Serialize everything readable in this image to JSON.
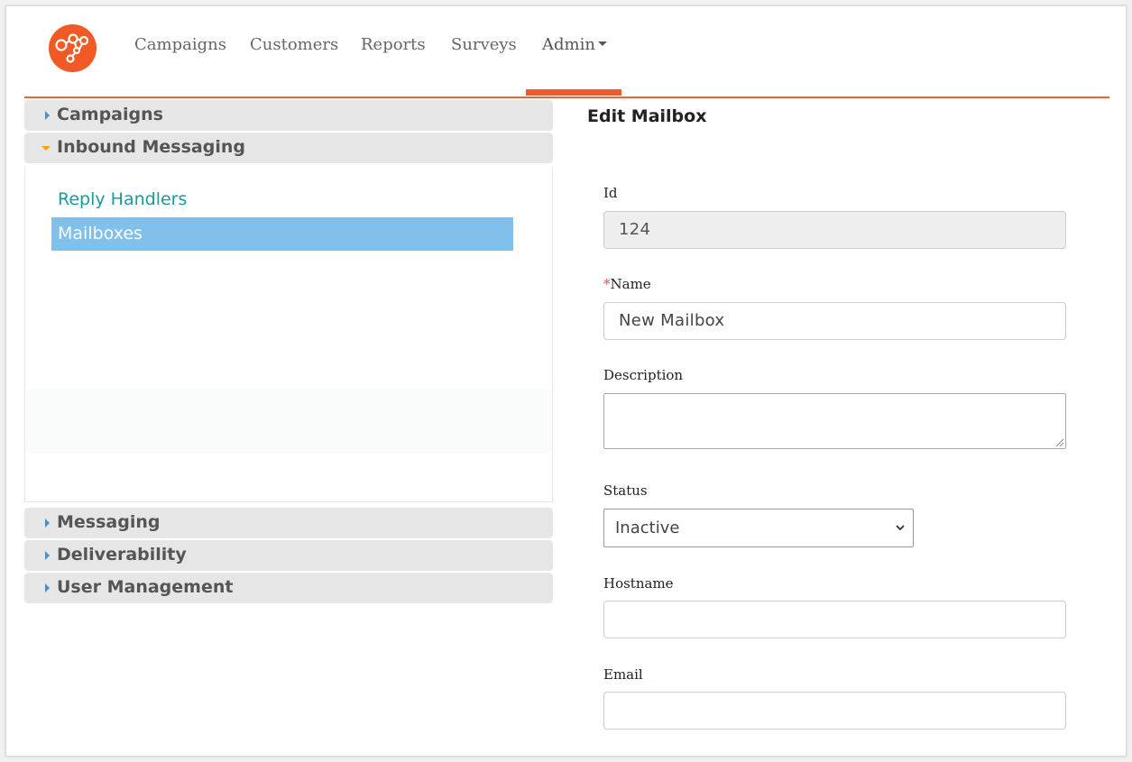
{
  "nav": {
    "items": [
      "Campaigns",
      "Customers",
      "Reports",
      "Surveys"
    ],
    "admin_label": "Admin",
    "active": "Admin"
  },
  "brand": {
    "accent": "#f15a24",
    "logo_icon": "network-nodes-icon"
  },
  "sidebar": {
    "sections": [
      {
        "label": "Campaigns",
        "expanded": false
      },
      {
        "label": "Inbound Messaging",
        "expanded": true
      },
      {
        "label": "Messaging",
        "expanded": false
      },
      {
        "label": "Deliverability",
        "expanded": false
      },
      {
        "label": "User Management",
        "expanded": false
      }
    ],
    "inbound_items": [
      {
        "label": "Reply Handlers",
        "selected": false
      },
      {
        "label": "Mailboxes",
        "selected": true
      }
    ],
    "selected_color": "#80c0ea",
    "link_color": "#1a9a9a"
  },
  "form": {
    "title": "Edit Mailbox",
    "id_label": "Id",
    "id_value": "124",
    "name_required_marker": "*",
    "name_label": "Name",
    "name_value": "New Mailbox",
    "description_label": "Description",
    "description_value": "",
    "status_label": "Status",
    "status_value": "Inactive",
    "hostname_label": "Hostname",
    "hostname_value": "",
    "email_label": "Email",
    "email_value": ""
  }
}
